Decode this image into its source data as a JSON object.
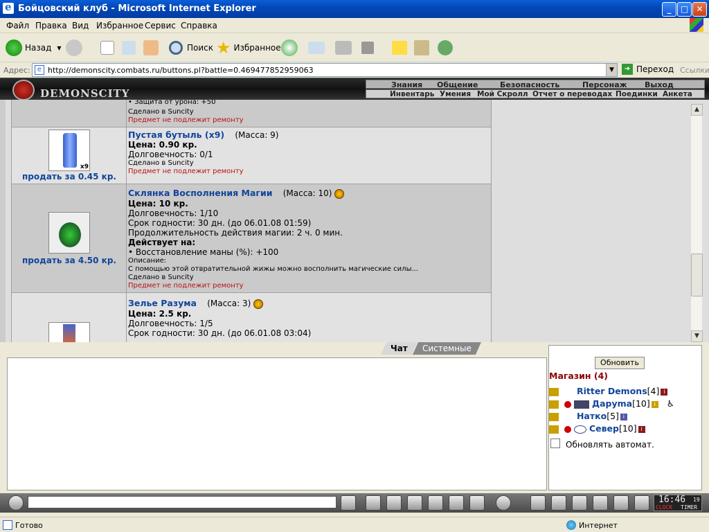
{
  "window": {
    "title": "Бойцовский клуб - Microsoft Internet Explorer",
    "min": "_",
    "max": "□",
    "close": "✕"
  },
  "menu": [
    "Файл",
    "Правка",
    "Вид",
    "Избранное",
    "Сервис",
    "Справка"
  ],
  "toolbar": {
    "back": "Назад",
    "search": "Поиск",
    "favorites": "Избранное"
  },
  "address": {
    "label": "Адрес:",
    "url": "http://demonscity.combats.ru/buttons.pl?battle=0.469477852959063",
    "go": "Переход",
    "links": "Ссылки"
  },
  "game": {
    "logo": "DEMONSCITY",
    "nav_top": [
      "Знания",
      "Общение",
      "Безопасность",
      "Персонаж",
      "Выход"
    ],
    "nav_bottom": [
      "Инвентарь",
      "Умения",
      "Мой Скролл",
      "Отчет о переводах",
      "Поединки",
      "Анкета"
    ]
  },
  "items": [
    {
      "partial_line": "• Защита от урона: +50",
      "made": "Сделано в Suncity",
      "repair": "Предмет не подлежит ремонту"
    },
    {
      "name": "Пустая бутыль (x9)",
      "mass": "(Масса: 9)",
      "price": "Цена: 0.90 кр.",
      "durability": "Долговечность: 0/1",
      "made": "Сделано в Suncity",
      "repair": "Предмет не подлежит ремонту",
      "sell": "продать за 0.45 кр.",
      "badge": "x9"
    },
    {
      "name": "Склянка Восполнения Магии",
      "mass": "(Масса: 10)",
      "price": "Цена: 10 кр.",
      "durability": "Долговечность: 1/10",
      "expiry": "Срок годности: 30 дн. (до 06.01.08 01:59)",
      "duration": "Продолжительность действия магии: 2 ч. 0 мин.",
      "acts_on": "Действует на:",
      "effect": "• Восстановление маны (%): +100",
      "desc_label": "Описание:",
      "desc": "С помощью этой отвратительной жижы можно восполнить магические силы...",
      "made": "Сделано в Suncity",
      "repair": "Предмет не подлежит ремонту",
      "sell": "продать за 4.50 кр."
    },
    {
      "name": "Зелье Разума",
      "mass": "(Масса: 3)",
      "price": "Цена: 2.5 кр.",
      "durability": "Долговечность: 1/5",
      "expiry": "Срок годности: 30 дн. (до 06.01.08 03:04)"
    }
  ],
  "chat": {
    "tab_chat": "Чат",
    "tab_system": "Системные сообщения"
  },
  "side": {
    "refresh": "Обновить",
    "location": "Магазин (4)",
    "users": [
      {
        "name": "Ritter Demons",
        "level": "[4]"
      },
      {
        "name": "Даруma",
        "level": "[10]"
      },
      {
        "name": "Натко",
        "level": "[5]"
      },
      {
        "name": "Север",
        "level": "[10]"
      }
    ],
    "auto": "Обновлять автомат."
  },
  "clock": {
    "time": "16:46",
    "sec": "19",
    "label1": "CLOCK",
    "label2": "TIMER"
  },
  "status": {
    "left": "Готово",
    "zone": "Интернет"
  }
}
